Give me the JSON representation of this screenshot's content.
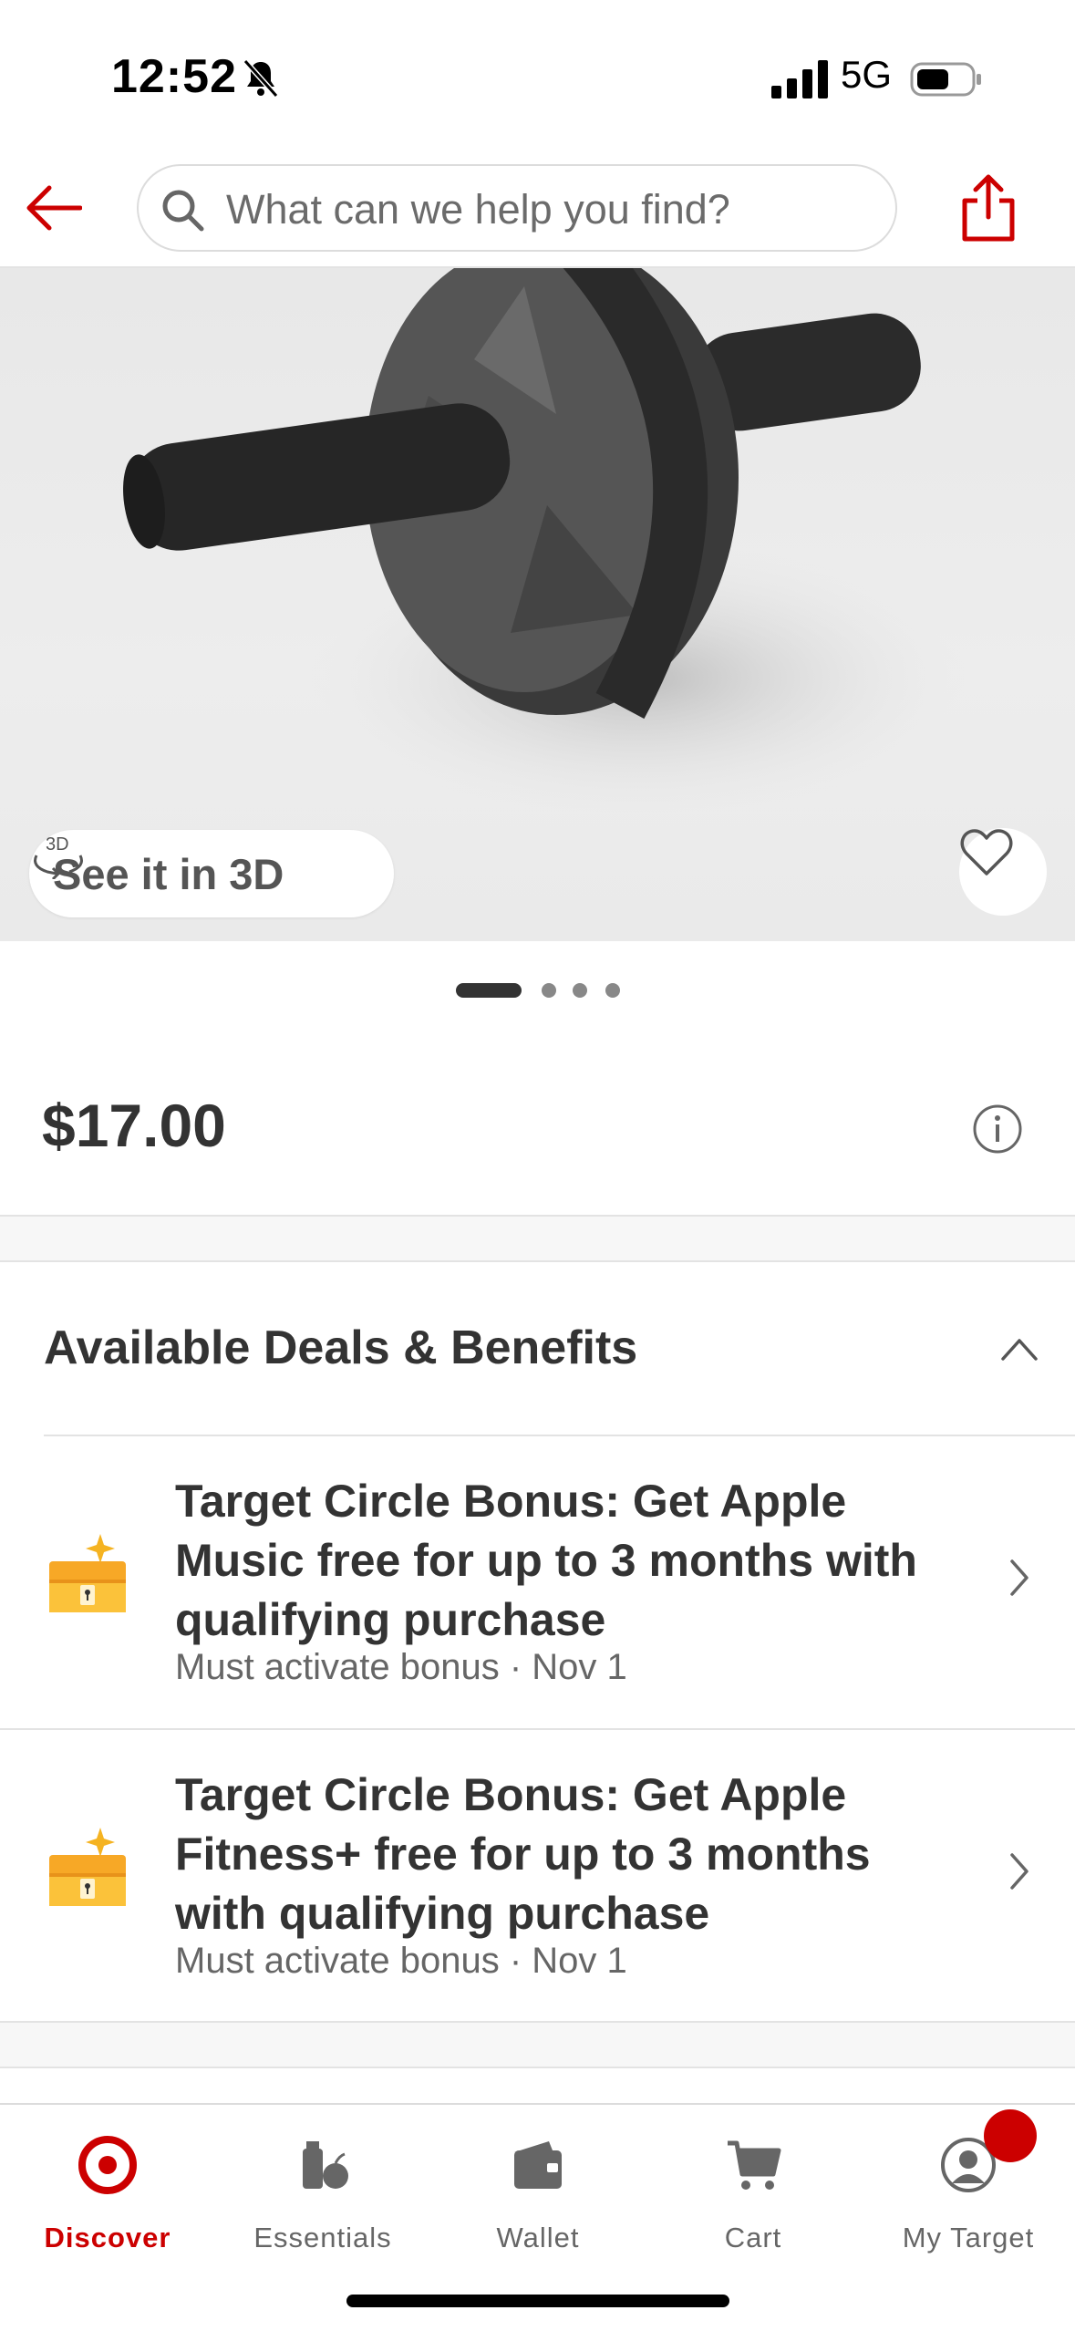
{
  "status_bar": {
    "time": "12:52",
    "network": "5G",
    "icons": [
      "bell-slash-icon",
      "signal-bars-icon",
      "battery-icon"
    ]
  },
  "header": {
    "back_icon": "arrow-left-icon",
    "search_placeholder": "What can we help you find?",
    "share_icon": "share-icon",
    "accent_color": "#cc0000"
  },
  "product": {
    "image_alt": "ab roller wheel",
    "see_in_3d_label": "See it in 3D",
    "see_in_3d_icon": "3d-rotate-icon",
    "favorite_icon": "heart-icon",
    "carousel": {
      "count": 4,
      "active_index": 0
    },
    "price": "$17.00"
  },
  "deals": {
    "title": "Available Deals & Benefits",
    "expanded": true,
    "items": [
      {
        "title": "Target Circle Bonus: Get Apple Music free for up to 3 months with qualifying purchase",
        "subtitle": "Must activate bonus · Nov 1",
        "icon": "treasure-chest-icon"
      },
      {
        "title": "Target Circle Bonus: Get Apple Fitness+ free for up to 3 months with qualifying purchase",
        "subtitle": "Must activate bonus · Nov 1",
        "icon": "treasure-chest-icon"
      }
    ]
  },
  "bottom_nav": {
    "items": [
      {
        "label": "Discover",
        "icon": "target-bullseye-icon",
        "active": true
      },
      {
        "label": "Essentials",
        "icon": "essentials-icon",
        "active": false
      },
      {
        "label": "Wallet",
        "icon": "wallet-icon",
        "active": false
      },
      {
        "label": "Cart",
        "icon": "cart-icon",
        "active": false
      },
      {
        "label": "My Target",
        "icon": "profile-icon",
        "active": false
      }
    ]
  }
}
